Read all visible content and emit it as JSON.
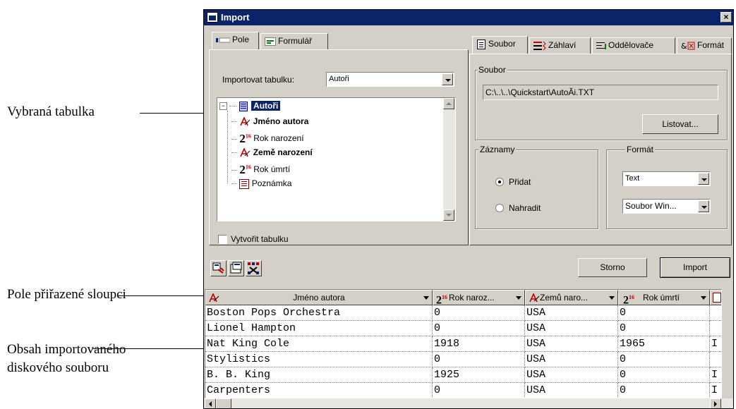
{
  "annotations": [
    {
      "text": "Vybraná tabulka"
    },
    {
      "text": "Pole přiřazené sloupci"
    },
    {
      "text": "Obsah importovaného diskového souboru"
    }
  ],
  "window": {
    "title": "Import",
    "close": "×"
  },
  "left_tabs": [
    "Pole",
    "Formulář"
  ],
  "right_tabs": [
    "Soubor",
    "Záhlaví",
    "Oddělovače",
    "Formát"
  ],
  "import_table": {
    "label": "Importovat tabulku:",
    "value": "Autoři"
  },
  "tree": {
    "root": "Autoři",
    "children": [
      {
        "label": "Jméno autora",
        "type": "text",
        "bold": true
      },
      {
        "label": "Rok narození",
        "type": "number",
        "bold": false
      },
      {
        "label": "Země narození",
        "type": "text",
        "bold": true
      },
      {
        "label": "Rok úmrtí",
        "type": "number",
        "bold": false
      },
      {
        "label": "Poznámka",
        "type": "memo",
        "bold": false
      }
    ]
  },
  "create_table_label": "Vytvořit tabulku",
  "soubor": {
    "group_title": "Soubor",
    "path": "C:\\..\\..\\Quickstart\\AutoĂi.TXT",
    "browse_label": "Listovat..."
  },
  "zaznamy": {
    "group_title": "Záznamy",
    "options": [
      "Přidat",
      "Nahradit"
    ],
    "selected": 0
  },
  "format": {
    "group_title": "Formát",
    "type_value": "Text",
    "encoding_value": "Soubor Win..."
  },
  "buttons": {
    "cancel": "Storno",
    "import": "Import"
  },
  "grid": {
    "columns": [
      {
        "label": "Jméno autora",
        "type": "text"
      },
      {
        "label": "Rok naroz...",
        "type": "number"
      },
      {
        "label": "Zemů naro...",
        "type": "text"
      },
      {
        "label": "Rok úmrtí",
        "type": "number"
      }
    ],
    "rows": [
      [
        "Boston Pops Orchestra",
        "0",
        "USA",
        "0",
        ""
      ],
      [
        "Lionel Hampton",
        "0",
        "USA",
        "0",
        ""
      ],
      [
        "Nat King Cole",
        "1918",
        "USA",
        "1965",
        "I"
      ],
      [
        "Stylistics",
        "0",
        "USA",
        "0",
        ""
      ],
      [
        "B. B. King",
        "1925",
        "USA",
        "0",
        "I"
      ],
      [
        "Carpenters",
        "0",
        "USA",
        "0",
        "I"
      ]
    ]
  },
  "colors": {
    "title_bar": "#0a246a",
    "face": "#d4d0c8",
    "selection": "#0a246a"
  }
}
